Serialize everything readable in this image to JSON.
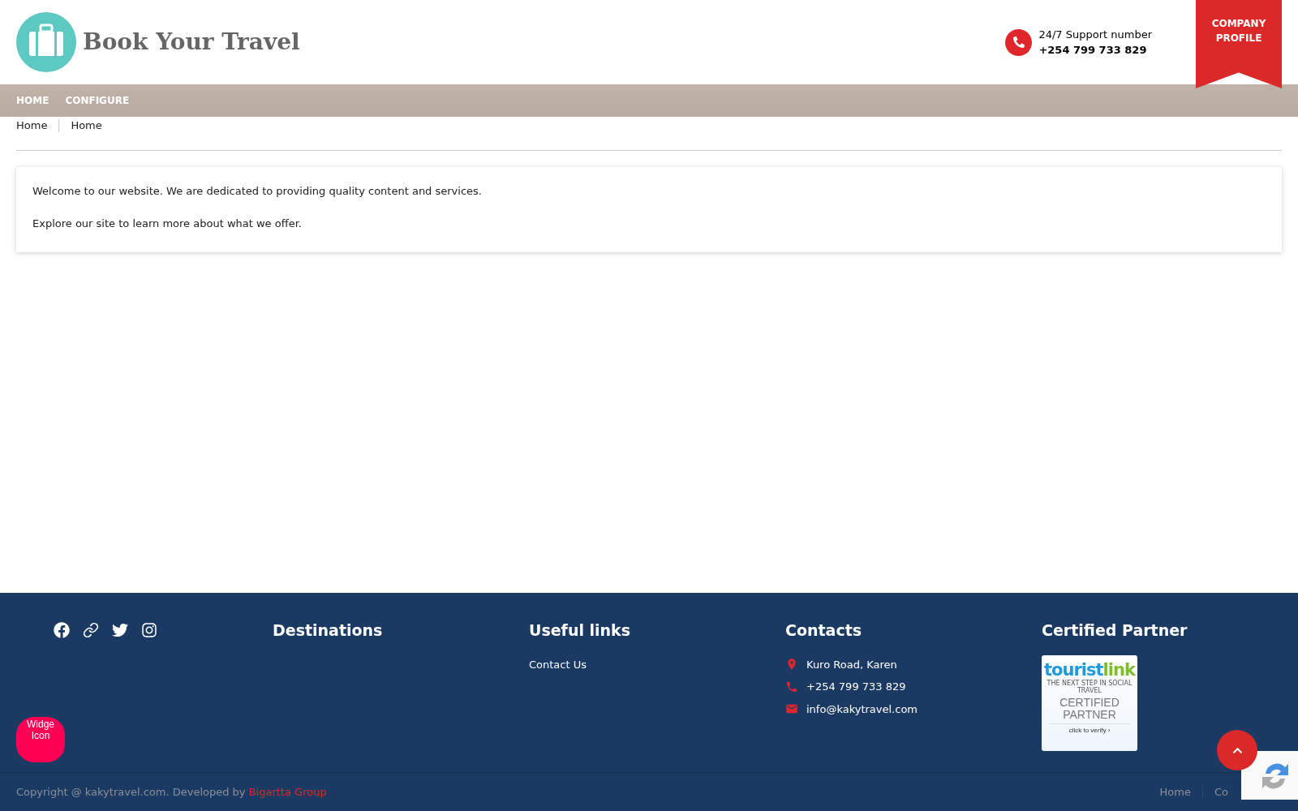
{
  "header": {
    "logo_text": "Book Your Travel",
    "support_label": "24/7 Support number",
    "support_phone": "+254 799 733 829",
    "ribbon_lines": [
      "COMPANY",
      "PROFILE"
    ]
  },
  "nav": {
    "items": [
      {
        "label": "HOME",
        "selected": false
      },
      {
        "label": "CONFIGURE",
        "selected": false
      }
    ]
  },
  "breadcrumb": [
    "Home",
    "Home"
  ],
  "content": {
    "paragraphs": [
      "Welcome to our website. We are dedicated to providing quality content and services.",
      "Explore our site to learn more about what we offer."
    ]
  },
  "footer": {
    "social": [
      {
        "kind": "facebook"
      },
      {
        "kind": "link"
      },
      {
        "kind": "twitter"
      },
      {
        "kind": "instagram"
      }
    ],
    "columns": [
      {
        "title": "Destinations"
      },
      {
        "title": "Useful links",
        "links": [
          "Contact Us"
        ]
      },
      {
        "title": "Contacts",
        "contacts": [
          {
            "kind": "address",
            "text": "Kuro Road, Karen"
          },
          {
            "kind": "phone",
            "text": "+254 799 733 829"
          },
          {
            "kind": "email",
            "text": "info@kakytravel.com"
          }
        ]
      },
      {
        "title": "Certified Partner",
        "badge": {
          "brand_a": "tourist",
          "brand_b": "link",
          "tagline": "THE NEXT STEP IN SOCIAL TRAVEL",
          "lines": [
            "CERTIFIED",
            "PARTNER"
          ],
          "verify": "click to verify ›"
        }
      }
    ],
    "copyright": "Copyright @ kakytravel.com. Developed by ",
    "developer": "Bigartta Group",
    "bottom_links": [
      "Home",
      "Co"
    ]
  },
  "widget": {
    "lines": [
      "Widge",
      "Icon"
    ]
  }
}
